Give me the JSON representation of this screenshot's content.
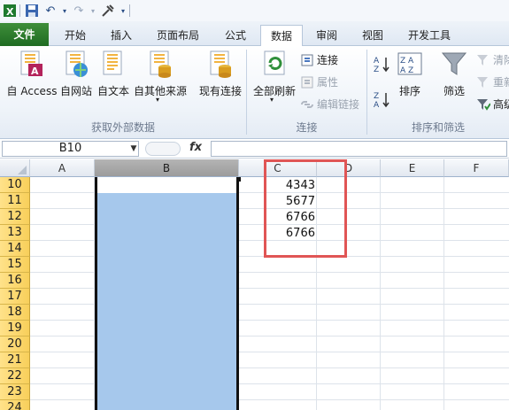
{
  "quick_access": {
    "icons": [
      "excel-icon",
      "save-icon",
      "undo-icon",
      "redo-icon",
      "customize-icon"
    ]
  },
  "tabs": [
    {
      "label": "文件"
    },
    {
      "label": "开始"
    },
    {
      "label": "插入"
    },
    {
      "label": "页面布局"
    },
    {
      "label": "公式"
    },
    {
      "label": "数据"
    },
    {
      "label": "审阅"
    },
    {
      "label": "视图"
    },
    {
      "label": "开发工具"
    }
  ],
  "ribbon": {
    "external": {
      "access": "自 Access",
      "web": "自网站",
      "text": "自文本",
      "other": "自其他来源",
      "existing": "现有连接",
      "group": "获取外部数据"
    },
    "connections": {
      "refresh_all": "全部刷新",
      "connections": "连接",
      "properties": "属性",
      "edit_links": "编辑链接",
      "group": "连接"
    },
    "sort_filter": {
      "sort": "排序",
      "filter": "筛选",
      "clear": "清除",
      "reapply": "重新",
      "advanced": "高级",
      "group": "排序和筛选"
    }
  },
  "formula_bar": {
    "name_box": "B10",
    "fx": "fx",
    "formula": ""
  },
  "columns": [
    "A",
    "B",
    "C",
    "D",
    "E",
    "F"
  ],
  "rows": [
    "10",
    "11",
    "12",
    "13",
    "14",
    "15",
    "16",
    "17",
    "18",
    "19",
    "20",
    "21",
    "22",
    "23",
    "24"
  ],
  "column_c_values": [
    "4343",
    "5677",
    "6766",
    "6766"
  ],
  "colors": {
    "selection": "#a6c8ec",
    "highlight_box": "#e05555",
    "file_tab": "#2a7a2a"
  }
}
